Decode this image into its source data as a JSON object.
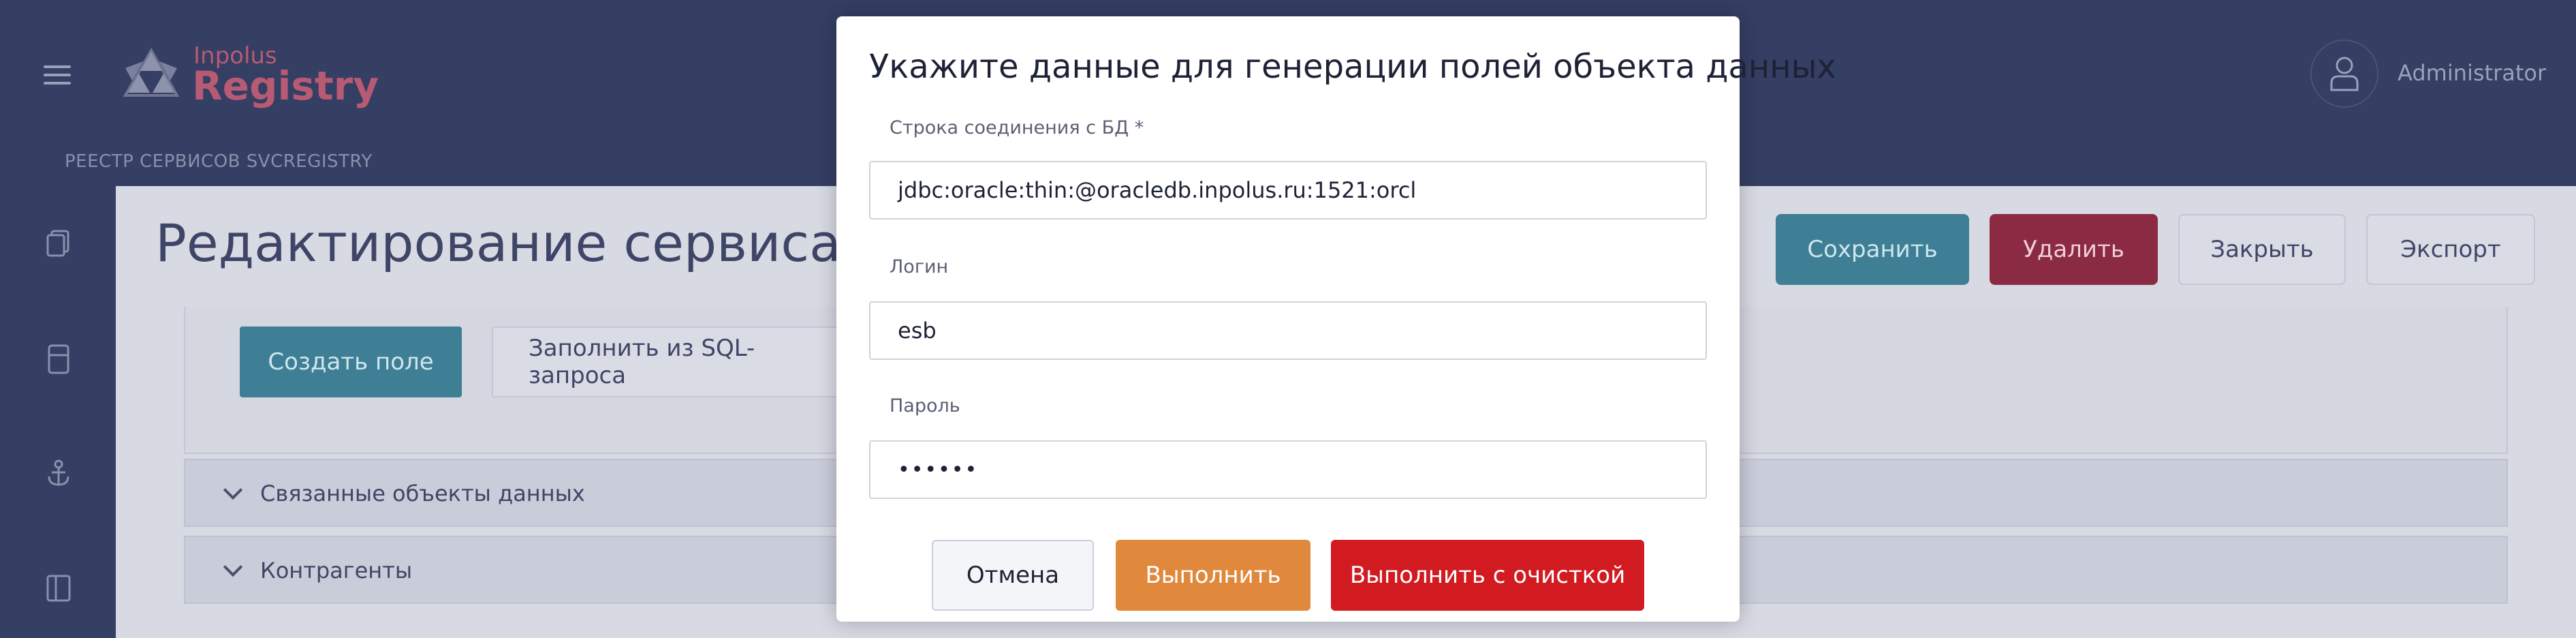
{
  "app": {
    "brand_small": "Inpolus",
    "brand_big": "Registry",
    "breadcrumb": "РЕЕСТР СЕРВИСОВ SVCREGISTRY",
    "user_name": "Administrator"
  },
  "page": {
    "title": "Редактирование сервиса «",
    "buttons": {
      "save": "Сохранить",
      "delete": "Удалить",
      "close": "Закрыть",
      "export": "Экспорт"
    },
    "panel": {
      "create_field": "Создать поле",
      "fill_from_sql": "Заполнить из SQL-запроса"
    },
    "accordions": [
      {
        "label": "Связанные объекты данных"
      },
      {
        "label": "Контрагенты"
      }
    ]
  },
  "modal": {
    "title": "Укажите данные для генерации полей объекта данных",
    "fields": {
      "connection": {
        "label": "Строка соединения с БД *",
        "value": "jdbc:oracle:thin:@oracledb.inpolus.ru:1521:orcl"
      },
      "login": {
        "label": "Логин",
        "value": "esb"
      },
      "password": {
        "label": "Пароль",
        "value": "••••••"
      }
    },
    "buttons": {
      "cancel": "Отмена",
      "execute": "Выполнить",
      "execute_clean": "Выполнить с очисткой"
    }
  },
  "colors": {
    "topbar": "#353e63",
    "accent_teal": "#3e7f95",
    "danger": "#d21b21",
    "orange": "#e0893d"
  }
}
